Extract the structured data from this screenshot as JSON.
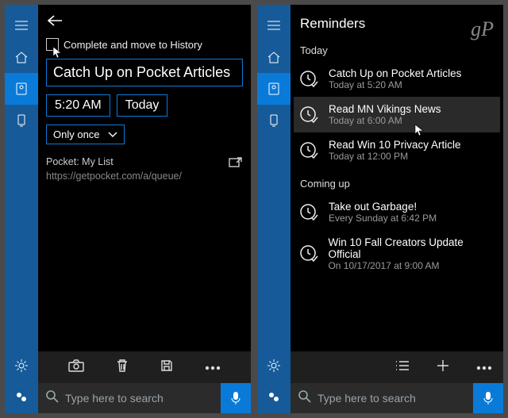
{
  "left": {
    "checkbox_label": "Complete and move to History",
    "title": "Catch Up on Pocket Articles",
    "time": "5:20 AM",
    "date_label": "Today",
    "recurrence": "Only once",
    "link_title": "Pocket: My List",
    "link_url": "https://getpocket.com/a/queue/",
    "search_placeholder": "Type here to search"
  },
  "right": {
    "header": "Reminders",
    "sections": {
      "today_label": "Today",
      "coming_label": "Coming up"
    },
    "today": [
      {
        "title": "Catch Up on Pocket Articles",
        "sub": "Today at 5:20 AM"
      },
      {
        "title": "Read MN Vikings News",
        "sub": "Today at 6:00 AM"
      },
      {
        "title": "Read Win 10 Privacy Article",
        "sub": "Today at 12:00 PM"
      }
    ],
    "coming": [
      {
        "title": "Take out Garbage!",
        "sub": "Every Sunday at 6:42 PM"
      },
      {
        "title": "Win 10 Fall Creators Update Official",
        "sub": "On 10/17/2017 at 9:00 AM"
      }
    ],
    "search_placeholder": "Type here to search",
    "watermark": "gP"
  }
}
